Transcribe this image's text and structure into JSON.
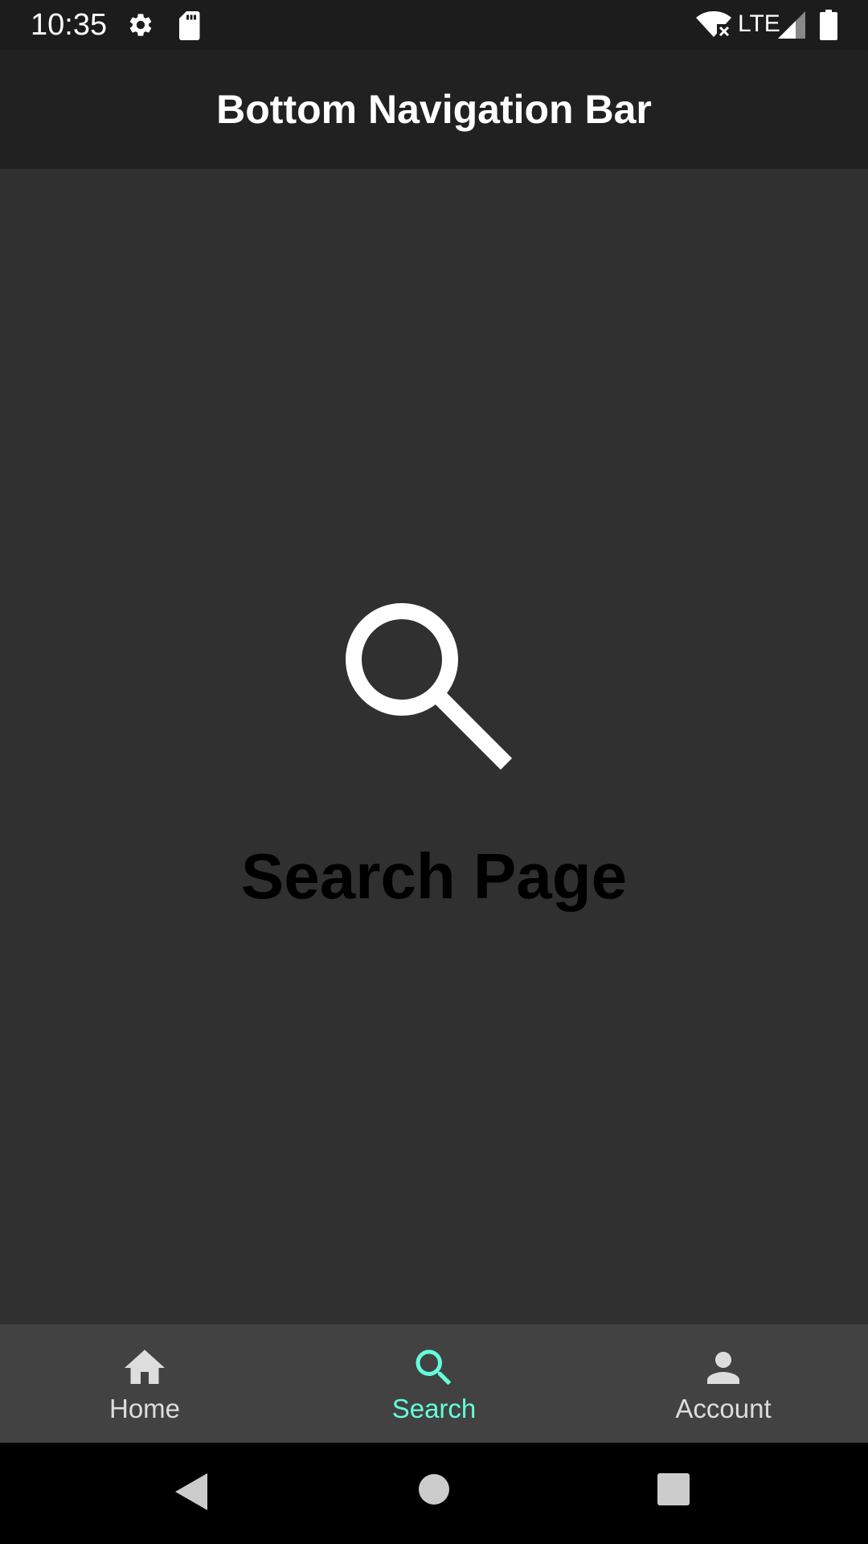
{
  "status_bar": {
    "time": "10:35",
    "network_label": "LTE",
    "icons": [
      "gear-icon",
      "sd-card-icon",
      "wifi-off-icon",
      "signal-icon",
      "battery-icon"
    ]
  },
  "app_bar": {
    "title": "Bottom Navigation Bar"
  },
  "main": {
    "icon": "search-icon",
    "heading": "Search Page"
  },
  "bottom_nav": {
    "selected_index": 1,
    "items": [
      {
        "label": "Home",
        "icon": "home-icon"
      },
      {
        "label": "Search",
        "icon": "search-icon"
      },
      {
        "label": "Account",
        "icon": "person-icon"
      }
    ]
  },
  "system_nav": {
    "buttons": [
      "back-icon",
      "home-circle-icon",
      "recents-icon"
    ]
  },
  "colors": {
    "status_bar_bg": "#1c1c1c",
    "app_bar_bg": "#212121",
    "content_bg": "#303030",
    "bottom_nav_bg": "#424242",
    "accent": "#64ffda",
    "inactive": "#dddddd",
    "heading_text": "#000000"
  }
}
